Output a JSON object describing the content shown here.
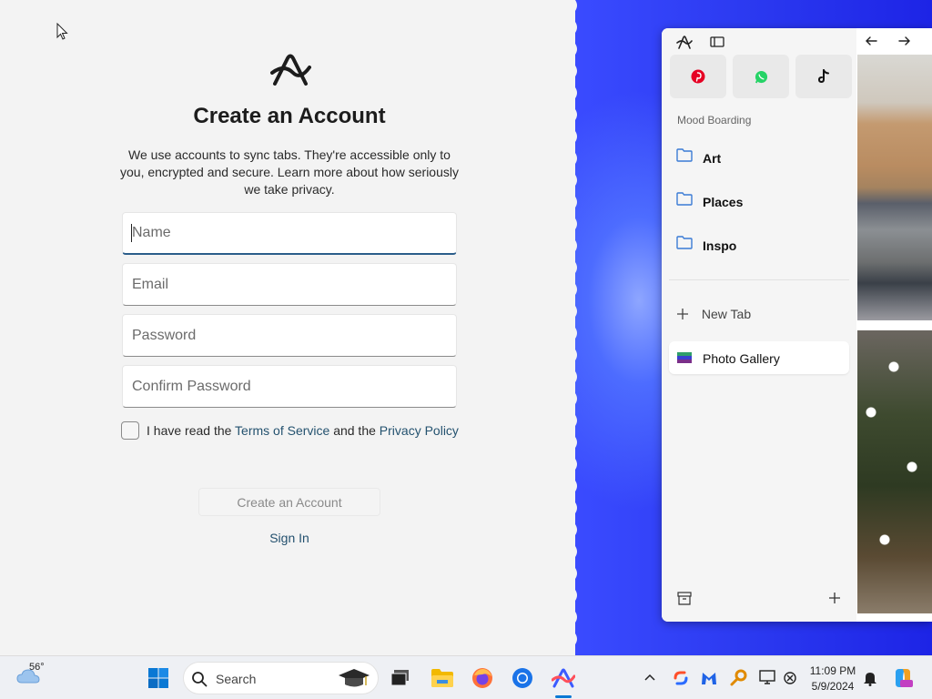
{
  "signup": {
    "title": "Create an Account",
    "description": "We use accounts to sync tabs. They're accessible only to you, encrypted and secure. Learn more about how seriously we take privacy.",
    "name_placeholder": "Name",
    "email_placeholder": "Email",
    "password_placeholder": "Password",
    "confirm_placeholder": "Confirm Password",
    "terms_prefix": "I have read the",
    "terms_link": "Terms of Service",
    "terms_mid": "and the",
    "privacy_link": "Privacy Policy",
    "create_button": "Create an Account",
    "signin_link": "Sign In"
  },
  "sidebar": {
    "pinned": [
      "pinterest-icon",
      "whatsapp-icon",
      "tiktok-icon"
    ],
    "section_title": "Mood Boarding",
    "folders": [
      {
        "label": "Art"
      },
      {
        "label": "Places"
      },
      {
        "label": "Inspo"
      }
    ],
    "new_tab_label": "New Tab",
    "active_tab_label": "Photo Gallery"
  },
  "taskbar": {
    "weather_temp": "56°",
    "search_label": "Search",
    "time": "11:09 PM",
    "date": "5/9/2024"
  },
  "colors": {
    "link": "#24526f",
    "desktop_blue": "#2b39f0",
    "pinterest": "#e60023",
    "whatsapp": "#25d366"
  }
}
